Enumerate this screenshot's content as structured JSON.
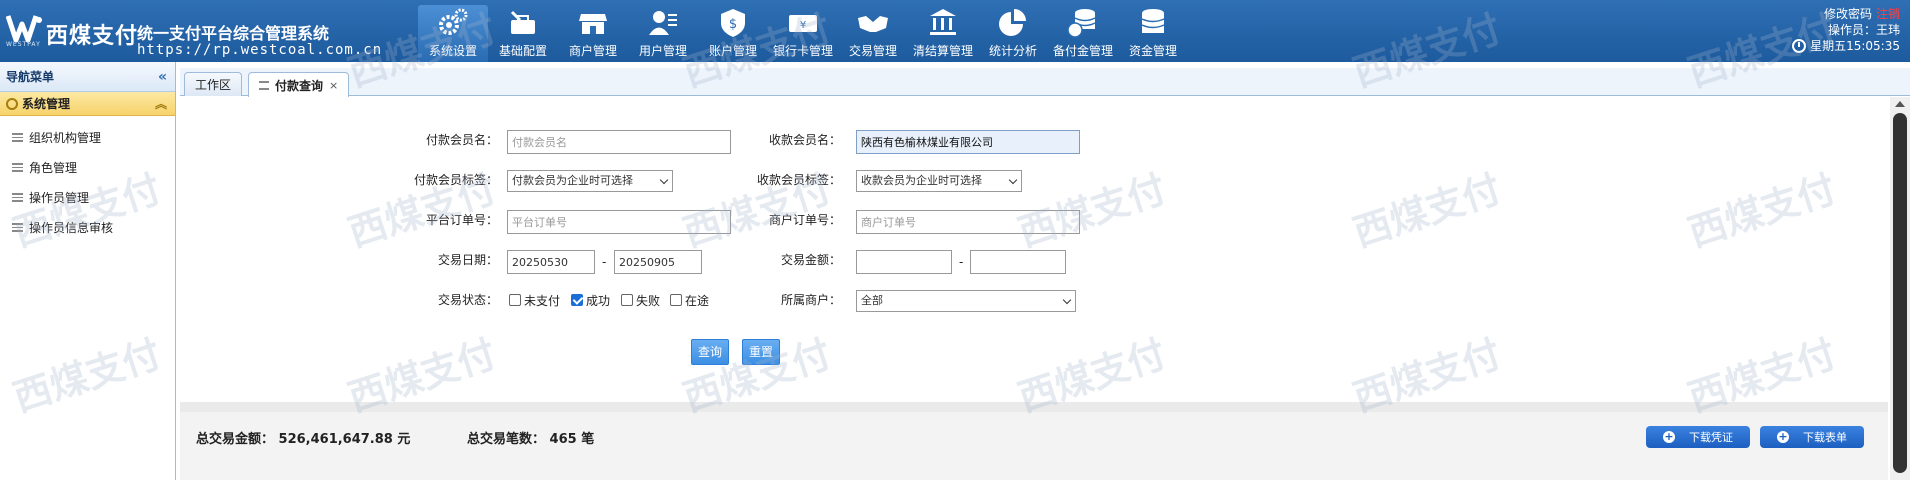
{
  "header": {
    "brand": "西煤支付",
    "brand_sub": "WESTPAY",
    "system_title": "统一支付平台综合管理系统",
    "url": "https://rp.westcoal.com.cn",
    "nav": [
      {
        "label": "系统设置",
        "icon": "gear-icon",
        "active": true
      },
      {
        "label": "基础配置",
        "icon": "toolbox-icon"
      },
      {
        "label": "商户管理",
        "icon": "store-icon"
      },
      {
        "label": "用户管理",
        "icon": "user-icon"
      },
      {
        "label": "账户管理",
        "icon": "shield-dollar-icon"
      },
      {
        "label": "银行卡管理",
        "icon": "bank-card-icon"
      },
      {
        "label": "交易管理",
        "icon": "handshake-icon"
      },
      {
        "label": "清结算管理",
        "icon": "bank-building-icon"
      },
      {
        "label": "统计分析",
        "icon": "pie-chart-icon"
      },
      {
        "label": "备付金管理",
        "icon": "coins-icon"
      },
      {
        "label": "资金管理",
        "icon": "coins-icon"
      }
    ],
    "change_password": "修改密码",
    "logout": "注销",
    "operator": "操作员：王玮",
    "datetime": "星期五15:05:35"
  },
  "sidebar": {
    "title": "导航菜单",
    "group": "系统管理",
    "items": [
      "组织机构管理",
      "角色管理",
      "操作员管理",
      "操作员信息审核"
    ]
  },
  "tabs": {
    "workspace": "工作区",
    "active": "付款查询",
    "close": "×"
  },
  "form": {
    "payer_name_label": "付款会员名：",
    "payer_name_placeholder": "付款会员名",
    "payee_name_label": "收款会员名：",
    "payee_name_value": "陕西有色榆林煤业有限公司",
    "payer_tag_label": "付款会员标签：",
    "payer_tag_value": "付款会员为企业时可选择",
    "payee_tag_label": "收款会员标签：",
    "payee_tag_value": "收款会员为企业时可选择",
    "platform_order_label": "平台订单号：",
    "platform_order_placeholder": "平台订单号",
    "merchant_order_label": "商户订单号：",
    "merchant_order_placeholder": "商户订单号",
    "trade_date_label": "交易日期：",
    "date_from": "20250530",
    "date_to": "20250905",
    "dash": "-",
    "amount_label": "交易金额：",
    "status_label": "交易状态：",
    "statuses": [
      {
        "label": "未支付",
        "checked": false
      },
      {
        "label": "成功",
        "checked": true
      },
      {
        "label": "失败",
        "checked": false
      },
      {
        "label": "在途",
        "checked": false
      }
    ],
    "merchant_label": "所属商户：",
    "merchant_value": "全部",
    "query_button": "查询",
    "reset_button": "重置"
  },
  "summary": {
    "total_amount": "总交易金额：  526,461,647.88 元",
    "total_count": "总交易笔数：  465 笔",
    "download_voucher": "下载凭证",
    "download_sheet": "下载表单"
  },
  "watermark": "西煤支付"
}
